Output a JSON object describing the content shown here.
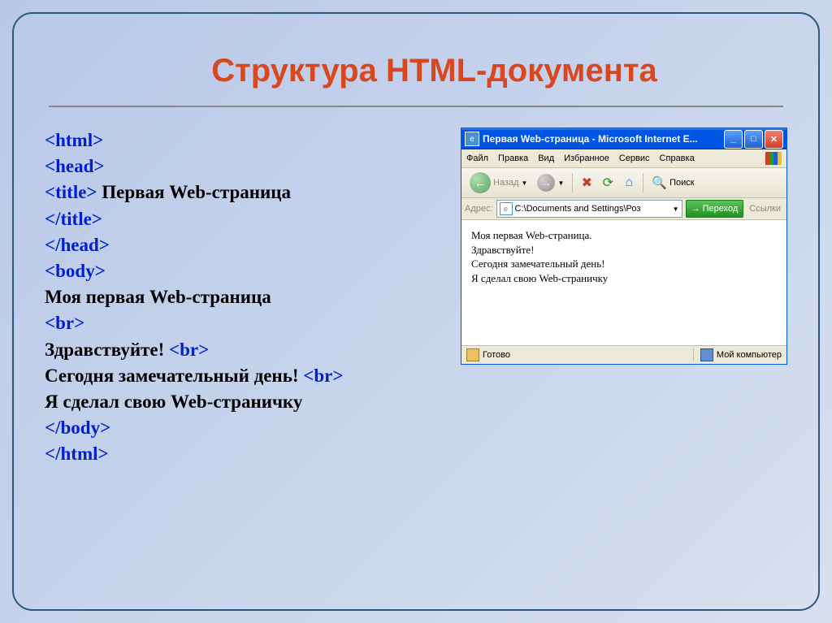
{
  "slide": {
    "title": "Структура HTML-документа"
  },
  "code": {
    "l1": "<html>",
    "l2": "<head>",
    "l3a": "<title>",
    "l3b": " Первая  Web-страница",
    "l4": "</title>",
    "l5": "</head>",
    "l6": "<body>",
    "l7": "Моя первая Web-страница",
    "l8": "<br>",
    "l9a": "Здравствуйте! ",
    "l9b": "<br>",
    "l10a": "Сегодня замечательный день! ",
    "l10b": "<br>",
    "l11": "Я сделал свою Web-страничку",
    "l12": "</body>",
    "l13": "</html>"
  },
  "browser": {
    "title": "Первая Web-страница - Microsoft Internet E...",
    "menu": {
      "file": "Файл",
      "edit": "Правка",
      "view": "Вид",
      "favorites": "Избранное",
      "tools": "Сервис",
      "help": "Справка"
    },
    "toolbar": {
      "back": "Назад",
      "search": "Поиск"
    },
    "address": {
      "label": "Адрес:",
      "value": "C:\\Documents and Settings\\Роз",
      "go": "Переход",
      "links": "Ссылки"
    },
    "page": {
      "line1": "Моя первая Web-страница.",
      "line2": "Здравствуйте!",
      "line3": "Сегодня замечательный день!",
      "line4": "Я сделал свою Web-страничку"
    },
    "status": {
      "done": "Готово",
      "zone": "Мой компьютер"
    }
  }
}
